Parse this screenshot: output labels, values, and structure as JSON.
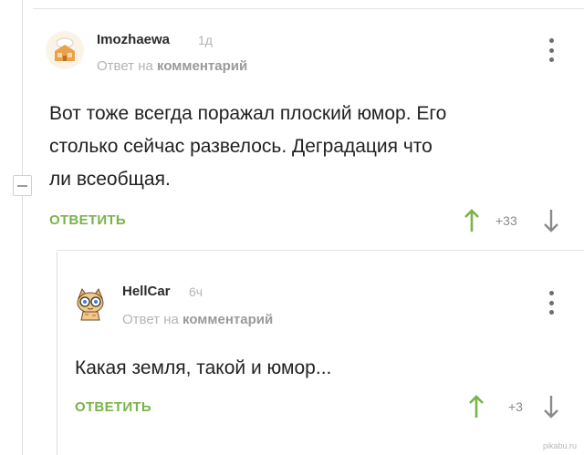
{
  "comments": [
    {
      "username": "Imozhaewa",
      "time": "1д",
      "reply_prefix": "Ответ на",
      "reply_target": "комментарий",
      "text_lines": [
        "Вот тоже всегда поражал плоский юмор. Его",
        "столько сейчас развелось. Деградация что",
        "ли всеобщая."
      ],
      "reply_label": "ОТВЕТИТЬ",
      "rating": "+33"
    },
    {
      "username": "HellCar",
      "time": "6ч",
      "reply_prefix": "Ответ на",
      "reply_target": "комментарий",
      "text_lines": [
        "Какая земля, такой и юмор..."
      ],
      "reply_label": "ОТВЕТИТЬ",
      "rating": "+3"
    }
  ],
  "watermark": "pikabu.ru",
  "colors": {
    "accent_green": "#79b349",
    "arrow_up": "#79b349",
    "arrow_down": "#8a8a8a",
    "muted": "#b4b4b4"
  },
  "icons": {
    "up_vote": "arrow-up-icon",
    "down_vote": "arrow-down-icon",
    "menu": "kebab-menu-icon",
    "collapse": "minus-icon"
  }
}
